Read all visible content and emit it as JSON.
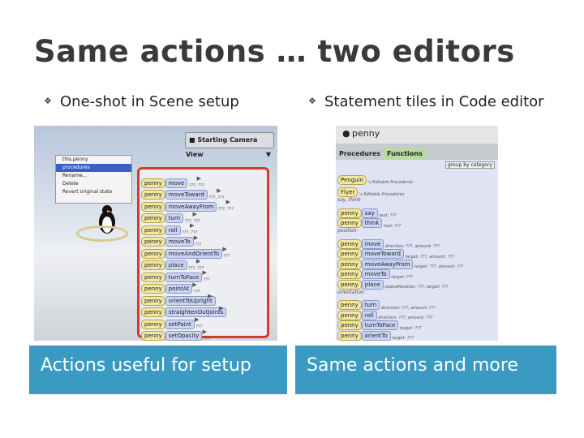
{
  "slide": {
    "title": "Same actions … two editors",
    "left_bullet": "One-shot in Scene setup",
    "right_bullet": "Statement tiles in Code editor",
    "left_caption": "Actions useful for setup",
    "right_caption": "Same actions and more"
  },
  "scene_editor": {
    "camera_label": "Starting Camera View",
    "context_menu": [
      "this.penny",
      "procedures",
      "Rename...",
      "Delete",
      "Revert original state"
    ],
    "selected_menu_item": "procedures",
    "procedures": [
      {
        "name": "move",
        "args": "???, ???"
      },
      {
        "name": "moveToward",
        "args": "???, ???"
      },
      {
        "name": "moveAwayFrom",
        "args": "???, ???"
      },
      {
        "name": "turn",
        "args": "???, ???"
      },
      {
        "name": "roll",
        "args": "???, ???"
      },
      {
        "name": "moveTo",
        "args": "???"
      },
      {
        "name": "moveAndOrientTo",
        "args": "???"
      },
      {
        "name": "place",
        "args": "???, ???"
      },
      {
        "name": "turnToFace",
        "args": "???"
      },
      {
        "name": "pointAt",
        "args": "???"
      },
      {
        "name": "orientToUpright",
        "args": ""
      },
      {
        "name": "straightenOutJoints",
        "args": ""
      },
      {
        "name": "setPaint",
        "args": "???"
      },
      {
        "name": "setOpacity",
        "args": "???"
      }
    ],
    "penny_label": "penny"
  },
  "code_editor": {
    "object_label": "penny",
    "tabs": [
      "Procedures",
      "Functions"
    ],
    "group_label": "group by category",
    "editable_rows": [
      {
        "tag": "Penguin",
        "text": "'s Editable Procedures"
      },
      {
        "tag": "Flyer",
        "text": "'s Editable Procedures"
      }
    ],
    "say_think_label": "say, think",
    "say_think": [
      {
        "name": "say",
        "args": "text: ???"
      },
      {
        "name": "think",
        "args": "text: ???"
      }
    ],
    "position_label": "position",
    "position": [
      {
        "name": "move",
        "args": "direction: ???, amount: ???"
      },
      {
        "name": "moveToward",
        "args": "target: ???, amount: ???"
      },
      {
        "name": "moveAwayFrom",
        "args": "target: ???, amount: ???"
      },
      {
        "name": "moveTo",
        "args": "target: ???"
      },
      {
        "name": "place",
        "args": "spatialRelation: ???, target: ???"
      }
    ],
    "orientation_label": "orientation",
    "orientation": [
      {
        "name": "turn",
        "args": "direction: ???, amount: ???"
      },
      {
        "name": "roll",
        "args": "direction: ???, amount: ???"
      },
      {
        "name": "turnToFace",
        "args": "target: ???"
      },
      {
        "name": "orientTo",
        "args": "target: ???"
      }
    ]
  },
  "colors": {
    "caption_bg": "#3b9ac2",
    "highlight_border": "#d83a2a",
    "tile_blue": "#c9d3f2",
    "tile_yellow": "#f1e8a2"
  }
}
